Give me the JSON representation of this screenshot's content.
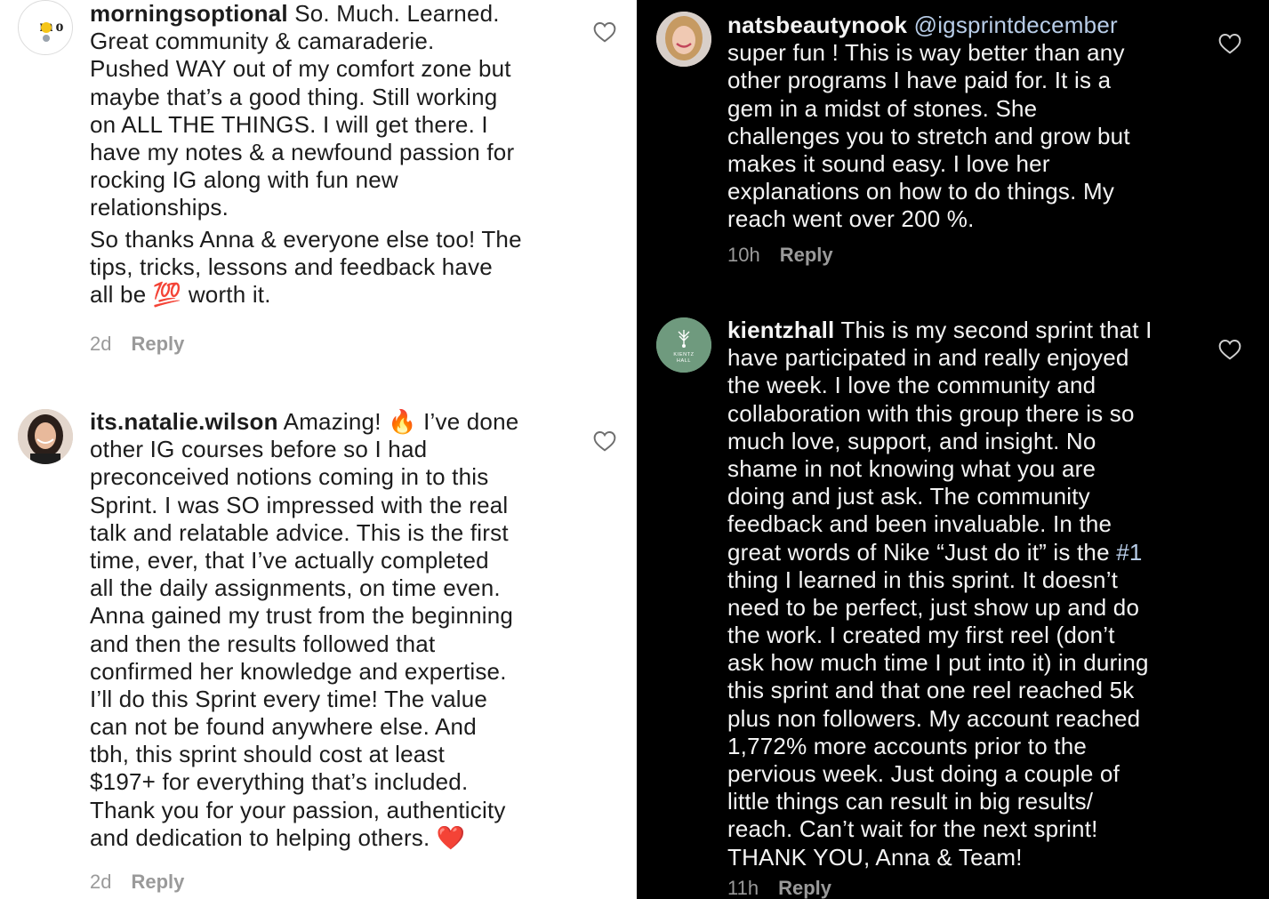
{
  "left_panel": {
    "comments": [
      {
        "username": "morningsoptional",
        "avatar_text": "m o",
        "lines": [
          "So. Much. Learned.",
          "Great community & camaraderie.",
          "Pushed WAY out of my comfort zone but",
          "maybe that’s a good thing. Still working",
          "on ALL THE THINGS. I will get there. I",
          "have my notes & a newfound passion for",
          "rocking IG along with fun new",
          "relationships.",
          "So thanks Anna & everyone else too! The",
          "tips, tricks, lessons and feedback have",
          "all be",
          "worth it."
        ],
        "emoji_100": "💯",
        "time": "2d",
        "reply_label": "Reply"
      },
      {
        "username": "its.natalie.wilson",
        "lines": [
          "Amazing!",
          "I’ve done",
          "other IG courses before so I had",
          "preconceived notions coming in to this",
          "Sprint. I was SO impressed with the real",
          "talk and relatable advice. This is the first",
          "time, ever, that I’ve actually completed",
          "all the daily assignments, on time even.",
          "Anna gained my trust from the beginning",
          "and then the results followed that",
          "confirmed her knowledge and expertise.",
          "I’ll do this Sprint every time! The value",
          "can not be found anywhere else. And",
          "tbh, this sprint should cost at least",
          "$197+ for everything that’s included.",
          "Thank you for your passion, authenticity",
          "and dedication to helping others."
        ],
        "emoji_fire": "🔥",
        "emoji_heart": "❤️",
        "time": "2d",
        "reply_label": "Reply"
      }
    ]
  },
  "right_panel": {
    "comments": [
      {
        "username": "natsbeautynook",
        "mention": "@igsprintdecember",
        "lines": [
          "super fun ! This is way better than any",
          "other programs I have paid for. It is a",
          "gem in a midst of stones.  She",
          "challenges you to stretch and grow but",
          "makes it sound easy. I love her",
          "explanations on how to do things. My",
          "reach went over 200 %."
        ],
        "time": "10h",
        "reply_label": "Reply"
      },
      {
        "username": "kientzhall",
        "avatar_text": "KIENTZ HALL",
        "lines": [
          "This is my second sprint that I",
          "have participated in and really enjoyed",
          "the week. I love the community and",
          "collaboration with this group there is so",
          "much love, support, and insight.  No",
          "shame in not knowing what you are",
          "doing and just ask. The community",
          "feedback and been invaluable.  In the",
          "great words of Nike “Just do it” is the",
          "thing I learned in this sprint. It doesn’t",
          "need to be perfect, just show up and do",
          "the work. I created my first reel (don’t",
          "ask how much time I put into it) in during",
          "this sprint and that one reel reached 5k",
          "plus non followers. My account reached",
          "1,772% more accounts prior to the",
          "pervious week. Just doing a couple of",
          "little things can result in big results/",
          "reach. Can’t wait for the next sprint!",
          "THANK YOU, Anna & Team!"
        ],
        "hashtag": "#1",
        "time": "11h",
        "reply_label": "Reply"
      }
    ]
  },
  "colors": {
    "left_bg": "#ffffff",
    "right_bg": "#000000",
    "meta_gray": "#9a9a9a",
    "link_blue": "#b8cde8",
    "kientz_green": "#6f9a7e"
  }
}
